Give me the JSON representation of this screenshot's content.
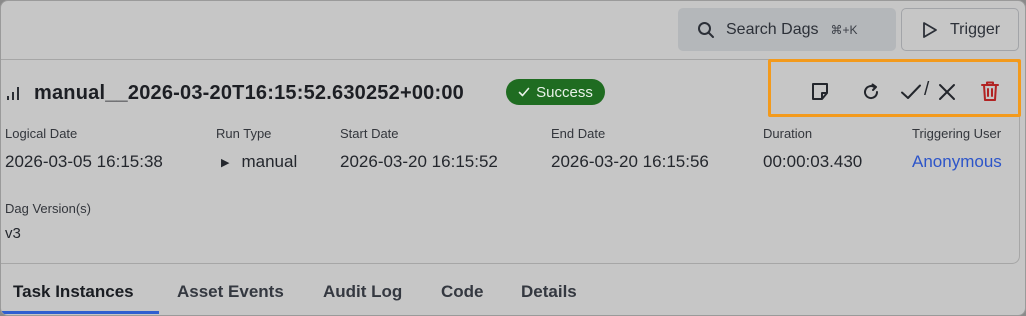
{
  "topbar": {
    "search_label": "Search Dags",
    "search_shortcut": "⌘+K",
    "trigger_label": "Trigger"
  },
  "run": {
    "title": "manual__2026-03-20T16:15:52.630252+00:00",
    "status": "Success",
    "status_color": "#1f6c21"
  },
  "actions": {
    "note_icon": "note-icon",
    "clear_icon": "refresh-icon",
    "mark_success_icon": "check-icon",
    "separator": "/",
    "mark_failed_icon": "x-icon",
    "delete_icon": "trash-icon",
    "highlight_color": "#f39a1c"
  },
  "fields": {
    "logical_date": {
      "label": "Logical Date",
      "value": "2026-03-05 16:15:38"
    },
    "run_type": {
      "label": "Run Type",
      "value": "manual"
    },
    "start_date": {
      "label": "Start Date",
      "value": "2026-03-20 16:15:52"
    },
    "end_date": {
      "label": "End Date",
      "value": "2026-03-20 16:15:56"
    },
    "duration": {
      "label": "Duration",
      "value": "00:00:03.430"
    },
    "triggering_user": {
      "label": "Triggering User",
      "value": "Anonymous"
    },
    "dag_version": {
      "label": "Dag Version(s)",
      "value": "v3"
    }
  },
  "tabs": [
    {
      "label": "Task Instances",
      "active": true
    },
    {
      "label": "Asset Events",
      "active": false
    },
    {
      "label": "Audit Log",
      "active": false
    },
    {
      "label": "Code",
      "active": false
    },
    {
      "label": "Details",
      "active": false
    }
  ]
}
